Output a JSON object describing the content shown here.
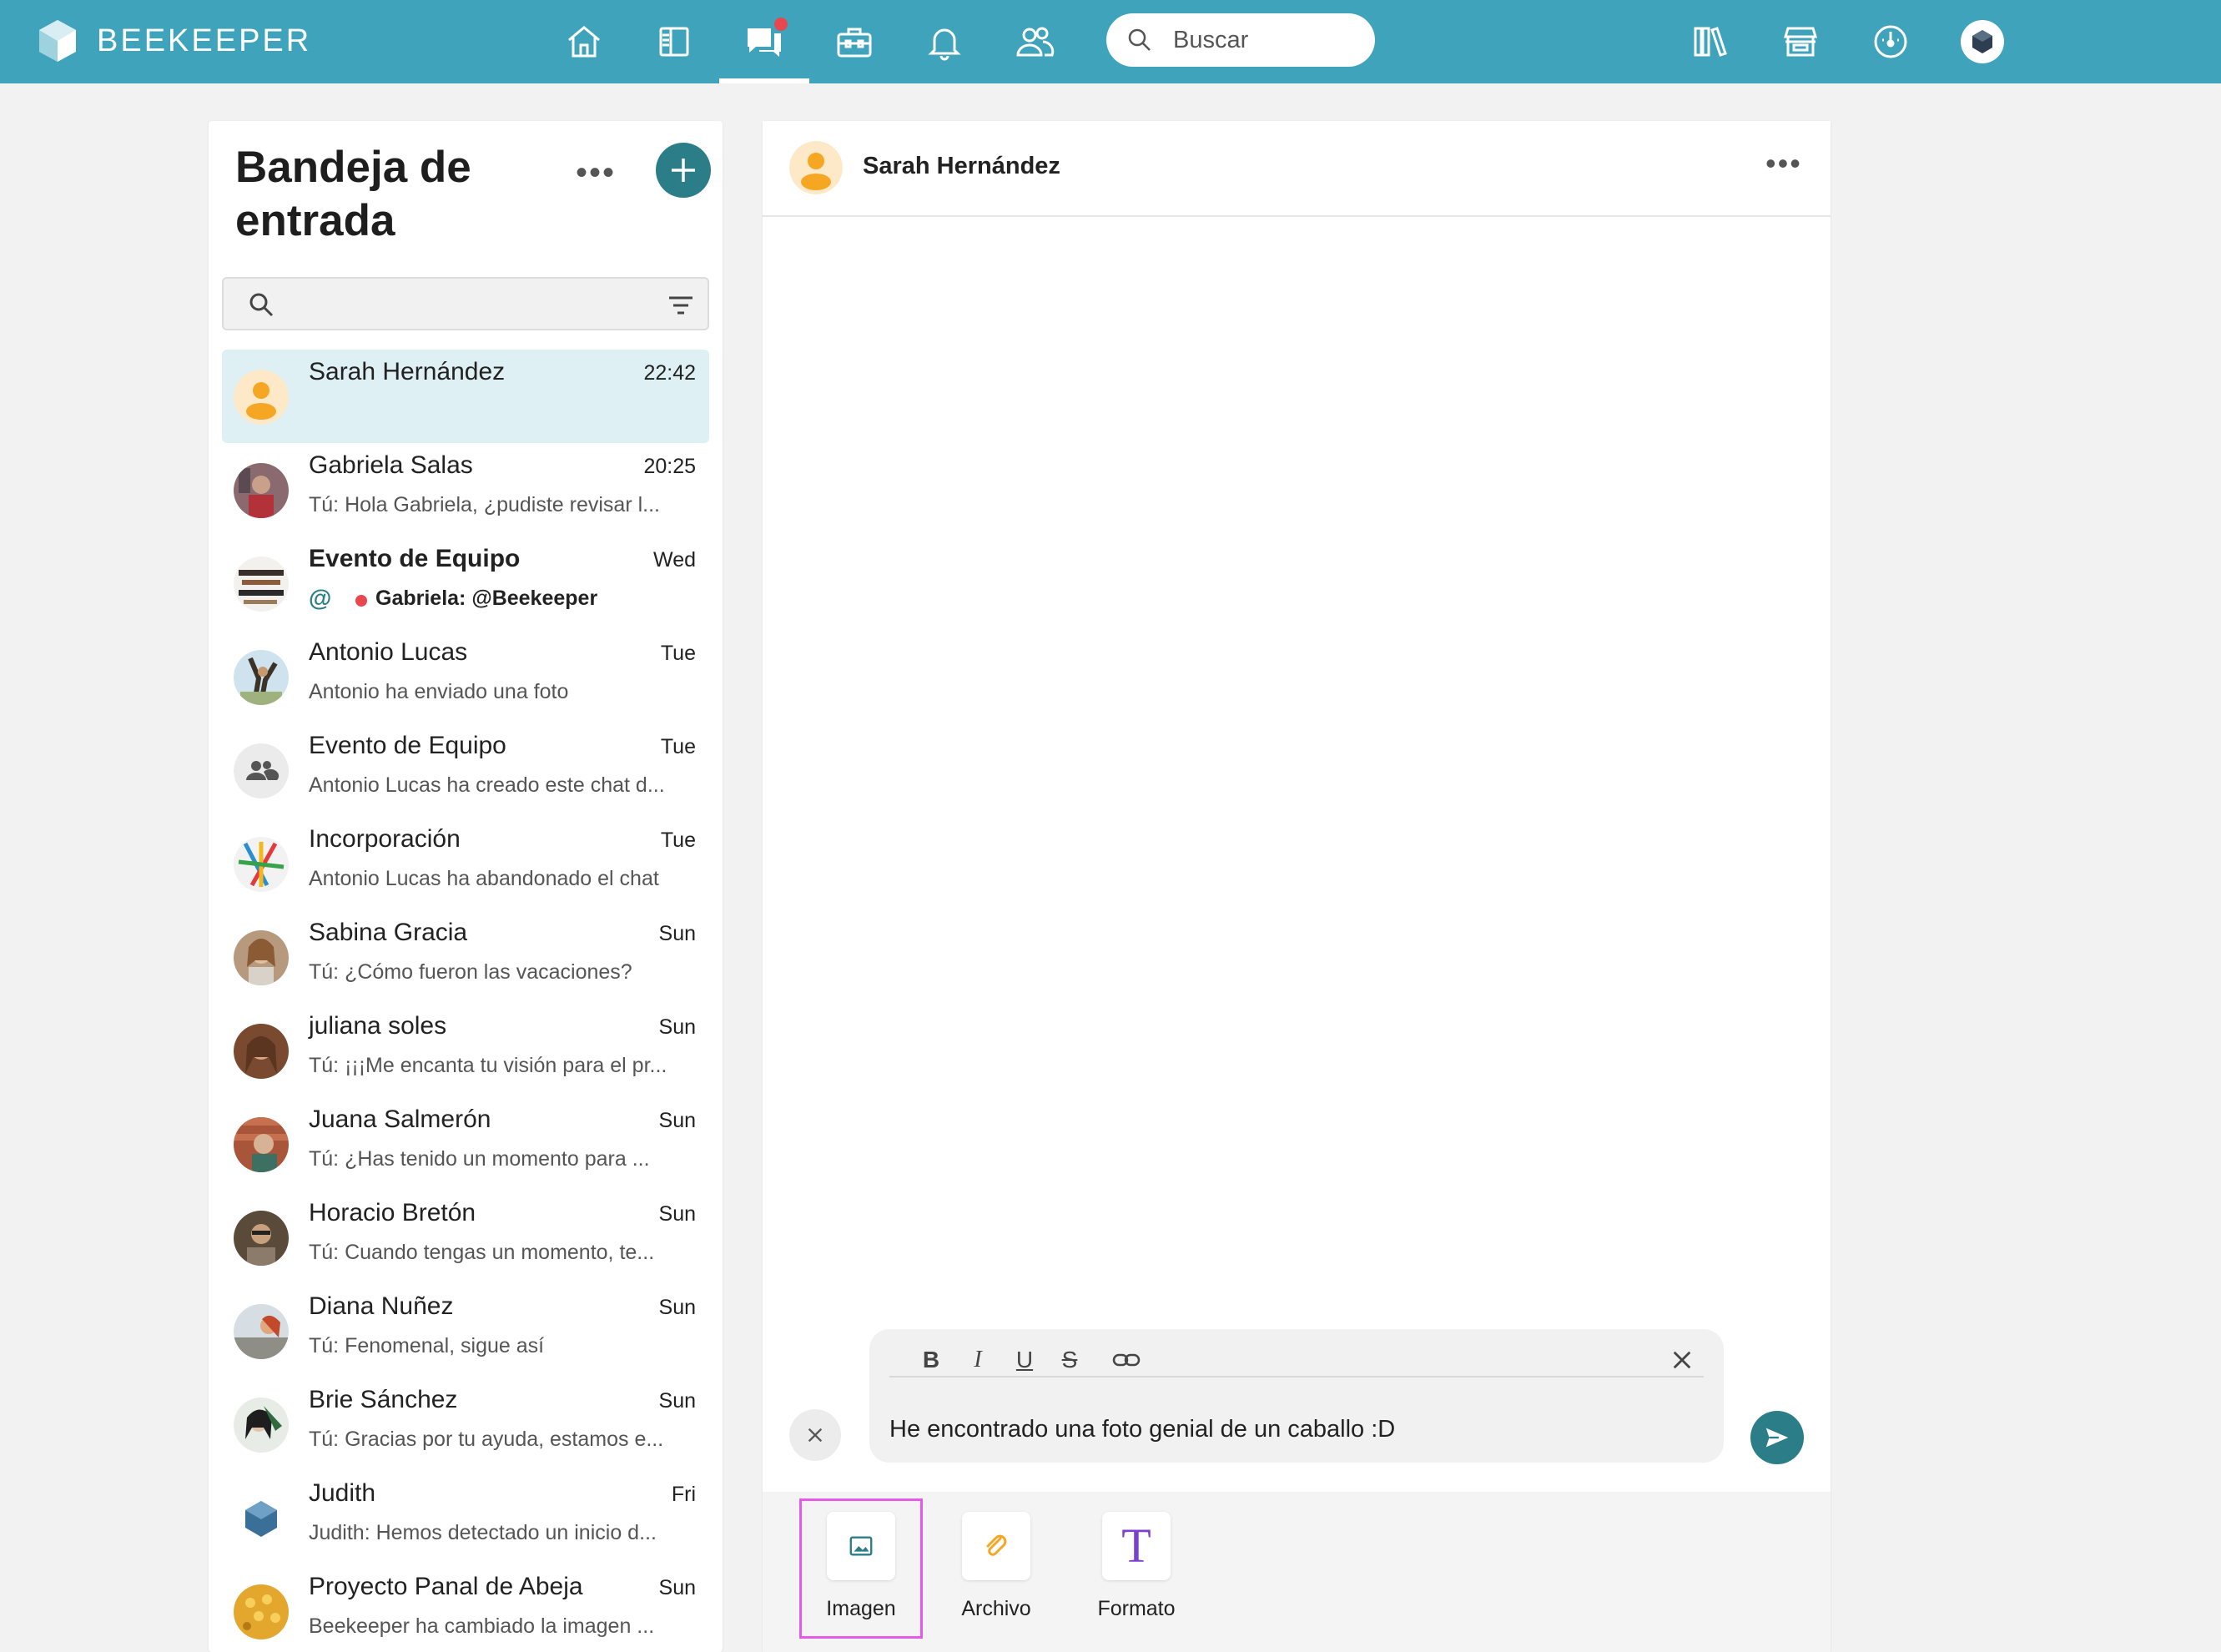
{
  "brand": {
    "name": "BEEKEEPER"
  },
  "search": {
    "placeholder": "Buscar"
  },
  "nav": {
    "items": [
      "home-icon",
      "streams-icon",
      "chat-icon",
      "toolbox-icon",
      "bell-icon",
      "people-icon"
    ],
    "active": "chat-icon",
    "right_items": [
      "library-icon",
      "store-icon",
      "dashboard-icon",
      "account-icon"
    ]
  },
  "inbox": {
    "title": "Bandeja de entrada",
    "conversations": [
      {
        "name": "Sarah Hernández",
        "time": "22:42",
        "preview": ""
      },
      {
        "name": "Gabriela Salas",
        "time": "20:25",
        "preview": "Tú: Hola Gabriela, ¿pudiste revisar l..."
      },
      {
        "name": "Evento de Equipo",
        "time": "Wed",
        "preview": "Gabriela: @Beekeeper",
        "mention": "@"
      },
      {
        "name": "Antonio Lucas",
        "time": "Tue",
        "preview": "Antonio ha enviado una foto"
      },
      {
        "name": "Evento de Equipo",
        "time": "Tue",
        "preview": "Antonio Lucas ha creado este chat d..."
      },
      {
        "name": "Incorporación",
        "time": "Tue",
        "preview": "Antonio Lucas ha abandonado el chat"
      },
      {
        "name": "Sabina Gracia",
        "time": "Sun",
        "preview": "Tú: ¿Cómo fueron las vacaciones?"
      },
      {
        "name": "juliana soles",
        "time": "Sun",
        "preview": "Tú: ¡¡¡Me encanta tu visión para el pr..."
      },
      {
        "name": "Juana Salmerón",
        "time": "Sun",
        "preview": "Tú: ¿Has tenido un momento para ..."
      },
      {
        "name": "Horacio Bretón",
        "time": "Sun",
        "preview": "Tú: Cuando tengas un momento, te..."
      },
      {
        "name": "Diana Nuñez",
        "time": "Sun",
        "preview": "Tú: Fenomenal, sigue así"
      },
      {
        "name": "Brie Sánchez",
        "time": "Sun",
        "preview": "Tú: Gracias por tu ayuda, estamos e..."
      },
      {
        "name": "Judith",
        "time": "Fri",
        "preview": "Judith: Hemos detectado un inicio d..."
      },
      {
        "name": "Proyecto Panal de Abeja",
        "time": "Sun",
        "preview": "Beekeeper ha cambiado la imagen ..."
      }
    ]
  },
  "chat": {
    "title": "Sarah Hernández",
    "composer": {
      "text": "He encontrado una foto genial de un caballo :D",
      "format_buttons": [
        "B",
        "I",
        "U",
        "S",
        "link"
      ]
    },
    "attachments": [
      {
        "label": "Imagen",
        "icon": "image-icon"
      },
      {
        "label": "Archivo",
        "icon": "paperclip-icon"
      },
      {
        "label": "Formato",
        "icon": "text-format-icon"
      }
    ]
  },
  "colors": {
    "topbar": "#3ea3bb",
    "accent": "#2b7d87",
    "notification": "#e8474f",
    "highlight": "#e35be6"
  }
}
